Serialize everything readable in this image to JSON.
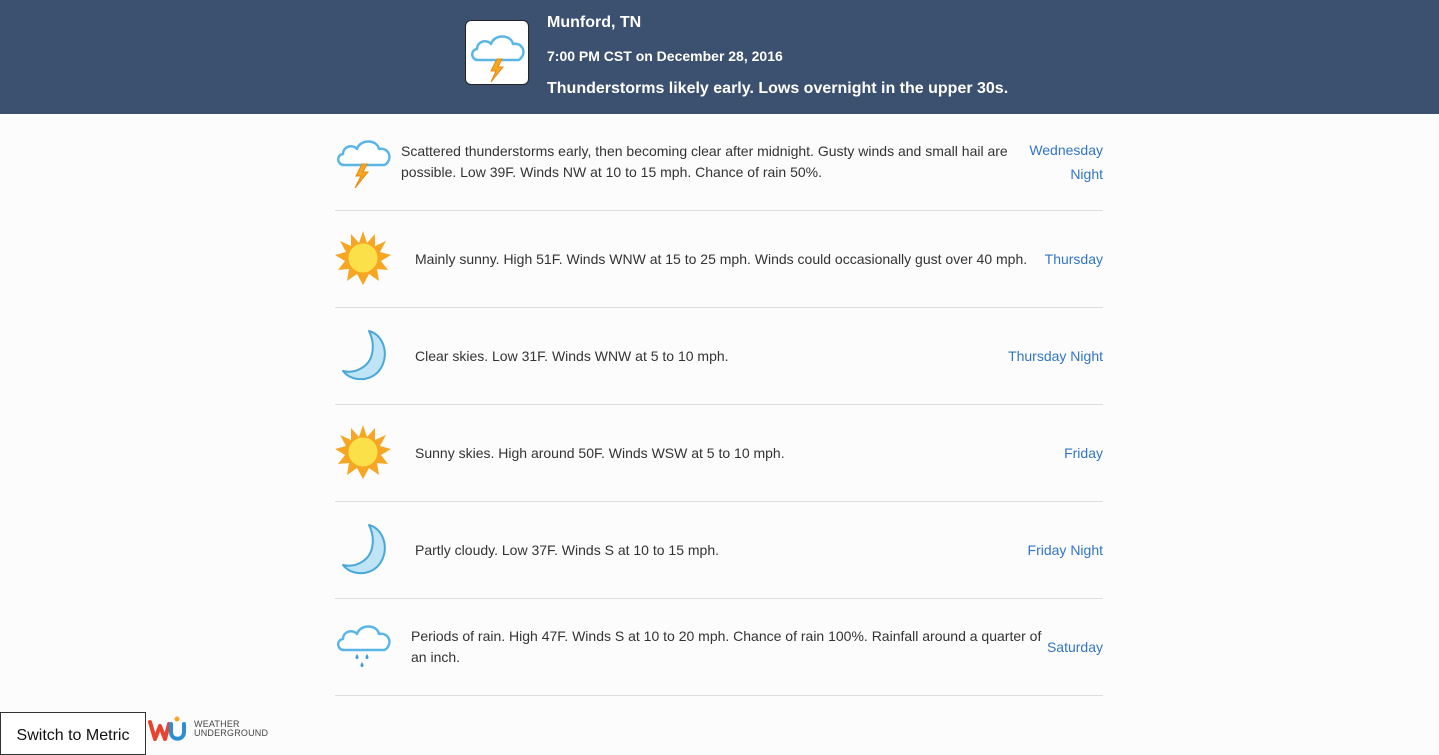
{
  "header": {
    "icon": "thunderstorm-icon",
    "location": "Munford, TN",
    "time": "7:00 PM CST on December 28, 2016",
    "summary": "Thunderstorms likely early. Lows overnight in the upper 30s."
  },
  "forecast": [
    {
      "icon": "thunderstorm-icon",
      "text": "Scattered thunderstorms early, then becoming clear after midnight. Gusty winds and small hail are possible. Low 39F. Winds NW at 10 to 15 mph. Chance of rain 50%.",
      "period": "Wednesday Night"
    },
    {
      "icon": "sun-icon",
      "text": "Mainly sunny. High 51F. Winds WNW at 15 to 25 mph. Winds could occasionally gust over 40 mph.",
      "period": "Thursday"
    },
    {
      "icon": "moon-icon",
      "text": "Clear skies. Low 31F. Winds WNW at 5 to 10 mph.",
      "period": "Thursday Night"
    },
    {
      "icon": "sun-icon",
      "text": "Sunny skies. High around 50F. Winds WSW at 5 to 10 mph.",
      "period": "Friday"
    },
    {
      "icon": "moon-icon",
      "text": "Partly cloudy. Low 37F. Winds S at 10 to 15 mph.",
      "period": "Friday Night"
    },
    {
      "icon": "rain-icon",
      "text": "Periods of rain. High 47F. Winds S at 10 to 20 mph. Chance of rain 100%. Rainfall around a quarter of an inch.",
      "period": "Saturday"
    }
  ],
  "footer": {
    "metric_button": "Switch to Metric",
    "brand_line1": "WEATHER",
    "brand_line2": "UNDERGROUND"
  },
  "colors": {
    "header_bg": "#3c516f",
    "link": "#3275c5",
    "cloud": "#5bb6e8",
    "bolt": "#f6a623",
    "sun": "#f7c21b",
    "moon": "#bfe4f5"
  }
}
